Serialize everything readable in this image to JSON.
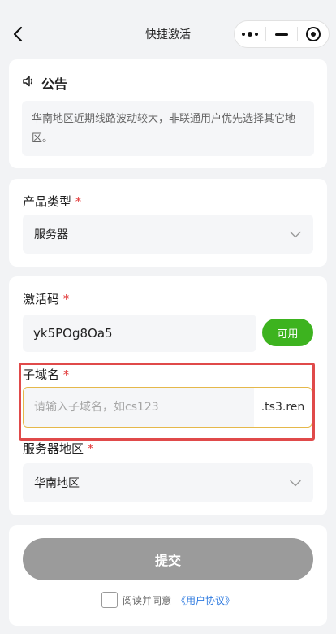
{
  "navbar": {
    "title": "快捷激活",
    "back_icon": "back-arrow-icon",
    "more_icon": "more-dots-icon",
    "minimize_icon": "minimize-icon",
    "close_icon": "target-circle-icon"
  },
  "notice": {
    "title": "公告",
    "icon": "speaker-icon",
    "content": "华南地区近期线路波动较大，非联通用户优先选择其它地区。"
  },
  "product": {
    "label": "产品类型",
    "required_mark": "*",
    "value": "服务器"
  },
  "activation": {
    "code_label": "激活码",
    "required_mark": "*",
    "code_value": "yk5POg8Oa5",
    "status_label": "可用",
    "status_color": "#3db31f",
    "subdomain_label": "子域名",
    "subdomain_placeholder": "请输入子域名，如cs123",
    "subdomain_suffix": ".ts3.ren",
    "region_label": "服务器地区",
    "region_value": "华南地区",
    "highlight_color": "#e04a4a"
  },
  "footer": {
    "submit_label": "提交",
    "agree_text": "阅读并同意",
    "agreement_link": "《用户协议》",
    "link_color": "#2f7be0"
  }
}
